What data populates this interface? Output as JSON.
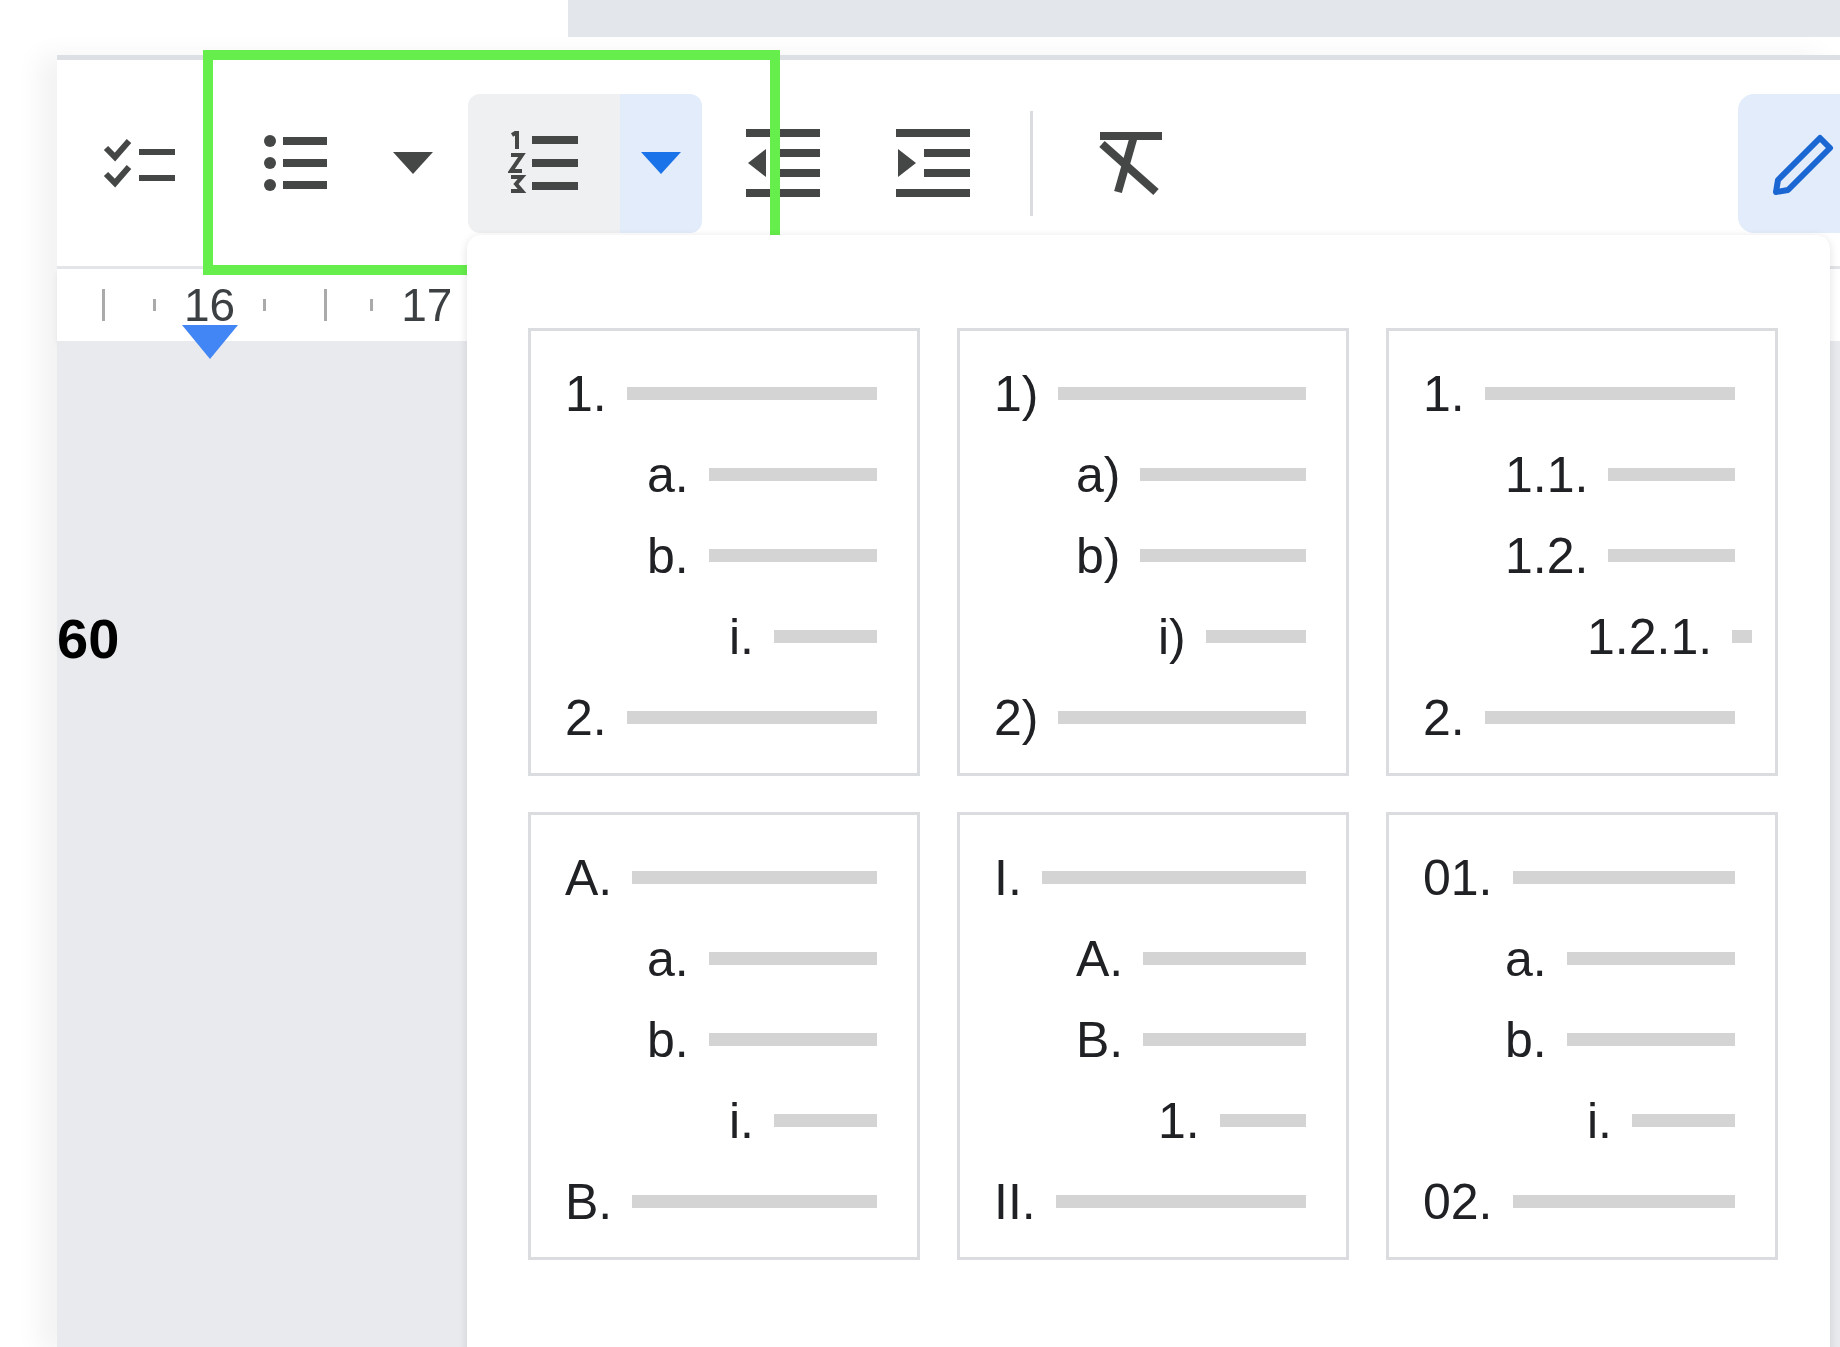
{
  "toolbar": {
    "buttons": [
      {
        "kind": "checklist",
        "selected": false
      },
      {
        "kind": "bulleted-list",
        "selected": false
      },
      {
        "kind": "bulleted-menu",
        "selected": false
      },
      {
        "kind": "numbered-list",
        "selected": true
      },
      {
        "kind": "numbered-menu",
        "selected": true
      },
      {
        "kind": "decrease-indent",
        "selected": false
      },
      {
        "kind": "increase-indent",
        "selected": false
      },
      {
        "kind": "clear-formatting",
        "selected": false
      },
      {
        "kind": "edit-mode",
        "selected": true
      }
    ]
  },
  "ruler": {
    "labels": [
      "16",
      "17"
    ]
  },
  "document": {
    "text": "60"
  },
  "numbered_list_menu": {
    "styles": [
      {
        "items": [
          {
            "label": "1.",
            "children": [
              {
                "label": "a."
              },
              {
                "label": "b.",
                "children": [
                  {
                    "label": "i."
                  }
                ]
              }
            ]
          },
          {
            "label": "2."
          }
        ]
      },
      {
        "items": [
          {
            "label": "1)",
            "children": [
              {
                "label": "a)"
              },
              {
                "label": "b)",
                "children": [
                  {
                    "label": "i)"
                  }
                ]
              }
            ]
          },
          {
            "label": "2)"
          }
        ]
      },
      {
        "items": [
          {
            "label": "1.",
            "children": [
              {
                "label": "1.1."
              },
              {
                "label": "1.2.",
                "children": [
                  {
                    "label": "1.2.1."
                  }
                ]
              }
            ]
          },
          {
            "label": "2."
          }
        ]
      },
      {
        "items": [
          {
            "label": "A.",
            "children": [
              {
                "label": "a."
              },
              {
                "label": "b.",
                "children": [
                  {
                    "label": "i."
                  }
                ]
              }
            ]
          },
          {
            "label": "B."
          }
        ]
      },
      {
        "items": [
          {
            "label": "I.",
            "children": [
              {
                "label": "A."
              },
              {
                "label": "B.",
                "children": [
                  {
                    "label": "1."
                  }
                ]
              }
            ]
          },
          {
            "label": "II."
          }
        ]
      },
      {
        "items": [
          {
            "label": "01.",
            "children": [
              {
                "label": "a."
              },
              {
                "label": "b.",
                "children": [
                  {
                    "label": "i."
                  }
                ]
              }
            ]
          },
          {
            "label": "02."
          }
        ]
      }
    ]
  }
}
